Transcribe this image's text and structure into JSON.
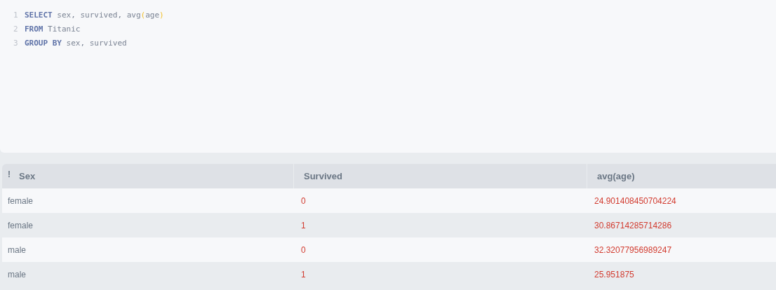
{
  "editor": {
    "lines": [
      {
        "number": "1",
        "tokens": [
          {
            "kind": "keyword",
            "text": "SELECT"
          },
          {
            "kind": "plain",
            "text": " sex, survived, avg"
          },
          {
            "kind": "paren",
            "text": "("
          },
          {
            "kind": "plain",
            "text": "age"
          },
          {
            "kind": "paren",
            "text": ")"
          }
        ]
      },
      {
        "number": "2",
        "tokens": [
          {
            "kind": "keyword",
            "text": "FROM"
          },
          {
            "kind": "plain",
            "text": " Titanic"
          }
        ]
      },
      {
        "number": "3",
        "tokens": [
          {
            "kind": "keyword",
            "text": "GROUP BY"
          },
          {
            "kind": "plain",
            "text": " sex, survived"
          }
        ]
      }
    ]
  },
  "table": {
    "marker": "!",
    "columns": [
      {
        "label": "Sex",
        "kind": "text"
      },
      {
        "label": "Survived",
        "kind": "number"
      },
      {
        "label": "avg(age)",
        "kind": "number"
      }
    ],
    "rows": [
      [
        "female",
        "0",
        "24.901408450704224"
      ],
      [
        "female",
        "1",
        "30.86714285714286"
      ],
      [
        "male",
        "0",
        "32.32077956989247"
      ],
      [
        "male",
        "1",
        "25.951875"
      ]
    ]
  }
}
